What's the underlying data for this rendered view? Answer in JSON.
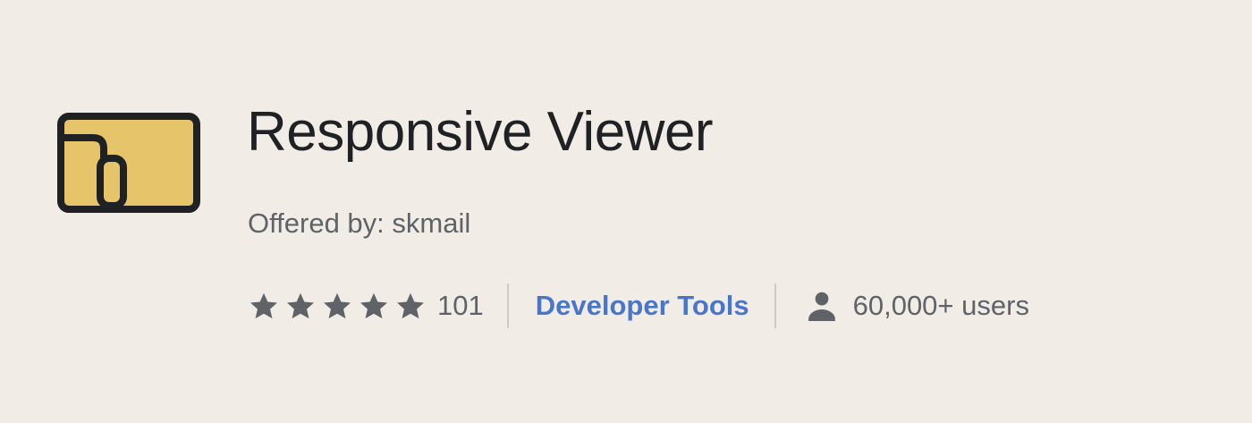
{
  "extension": {
    "title": "Responsive Viewer",
    "offered_by": "Offered by: skmail",
    "rating": {
      "stars": 5,
      "count": "101"
    },
    "category": "Developer Tools",
    "users": "60,000+ users"
  },
  "colors": {
    "background": "#f1ede6",
    "logo_fill": "#e6c46a",
    "logo_stroke": "#202124",
    "link": "#4a76c9",
    "muted_text": "#5f6368",
    "star": "#5f6368"
  },
  "icons": {
    "logo": "responsive-viewer-logo-icon",
    "star": "star-icon",
    "user": "person-icon"
  }
}
